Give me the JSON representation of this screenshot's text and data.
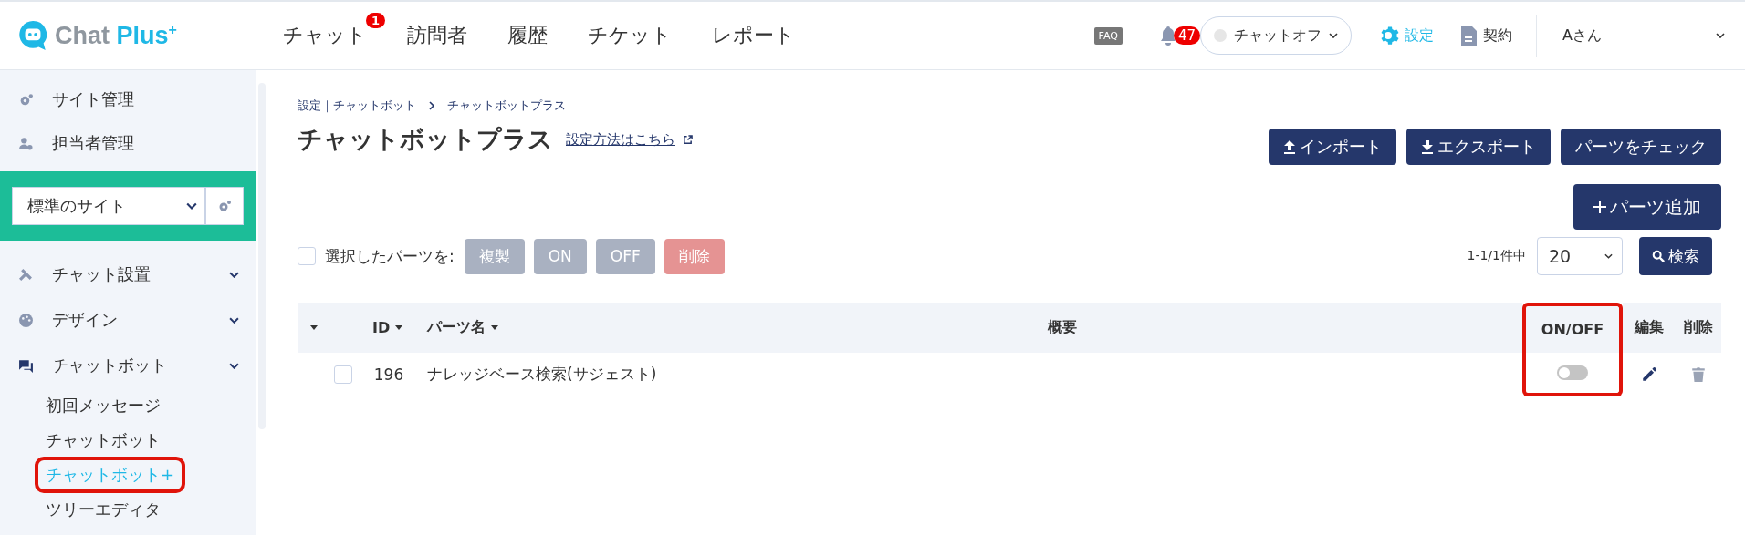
{
  "header": {
    "logo": {
      "word1": "Chat",
      "word2": "Plus",
      "mark": "+"
    },
    "nav": [
      {
        "label": "チャット",
        "badge": "1"
      },
      {
        "label": "訪問者"
      },
      {
        "label": "履歴"
      },
      {
        "label": "チケット"
      },
      {
        "label": "レポート"
      }
    ],
    "faq": "FAQ",
    "notifications": "47",
    "chat_status": {
      "label": "チャットオフ",
      "on": false
    },
    "settings": {
      "label": "設定",
      "selected": true
    },
    "contract": {
      "label": "契約",
      "selected": false
    },
    "user": "Aさん"
  },
  "sidebar": {
    "top_items": [
      {
        "label": "サイト管理",
        "kind": "gear"
      },
      {
        "label": "担当者管理",
        "kind": "user"
      }
    ],
    "site_select": {
      "value": "標準のサイト"
    },
    "sections": [
      {
        "label": "チャット設置",
        "kind": "tools"
      },
      {
        "label": "デザイン",
        "kind": "palette"
      },
      {
        "label": "チャットボット",
        "kind": "chat",
        "children": [
          {
            "label": "初回メッセージ",
            "selected": false,
            "highlighted": false
          },
          {
            "label": "チャットボット",
            "selected": false,
            "highlighted": false
          },
          {
            "label": "チャットボット+",
            "selected": true,
            "highlighted": true
          },
          {
            "label": "ツリーエディタ",
            "selected": false,
            "highlighted": false
          }
        ]
      }
    ]
  },
  "breadcrumb": [
    "設定｜チャットボット",
    "チャットボットプラス"
  ],
  "page": {
    "title": "チャットボットプラス",
    "help_link": "設定方法はこちら"
  },
  "actions": [
    {
      "label": "インポート",
      "kind": "upload"
    },
    {
      "label": "エクスポート",
      "kind": "download"
    },
    {
      "label": "パーツをチェック",
      "kind": "plain"
    }
  ],
  "add_button": "パーツ追加",
  "bulk": {
    "label": "選択したパーツを:",
    "checked": false,
    "buttons": [
      {
        "label": "複製",
        "kind": "neutral",
        "disabled": true
      },
      {
        "label": "ON",
        "kind": "neutral",
        "disabled": true
      },
      {
        "label": "OFF",
        "kind": "neutral",
        "disabled": true
      },
      {
        "label": "削除",
        "kind": "danger",
        "disabled": true
      }
    ]
  },
  "pagination": {
    "count": "1-1/1件中",
    "per_page": "20",
    "search": "検索"
  },
  "table": {
    "columns": [
      {
        "sortable": true,
        "highlighted": false
      },
      {
        "label": "ID",
        "sortable": true,
        "highlighted": false
      },
      {
        "label": "パーツ名",
        "sortable": true,
        "highlighted": false
      },
      {
        "label": "概要",
        "sortable": false,
        "highlighted": false
      },
      {
        "label": "ON/OFF",
        "sortable": false,
        "highlighted": true
      },
      {
        "label": "編集",
        "sortable": false,
        "highlighted": false
      },
      {
        "label": "削除",
        "sortable": false,
        "highlighted": false
      }
    ],
    "rows": [
      {
        "checked": false,
        "id": "196",
        "name": "ナレッジベース検索(サジェスト)",
        "on": false
      }
    ]
  }
}
